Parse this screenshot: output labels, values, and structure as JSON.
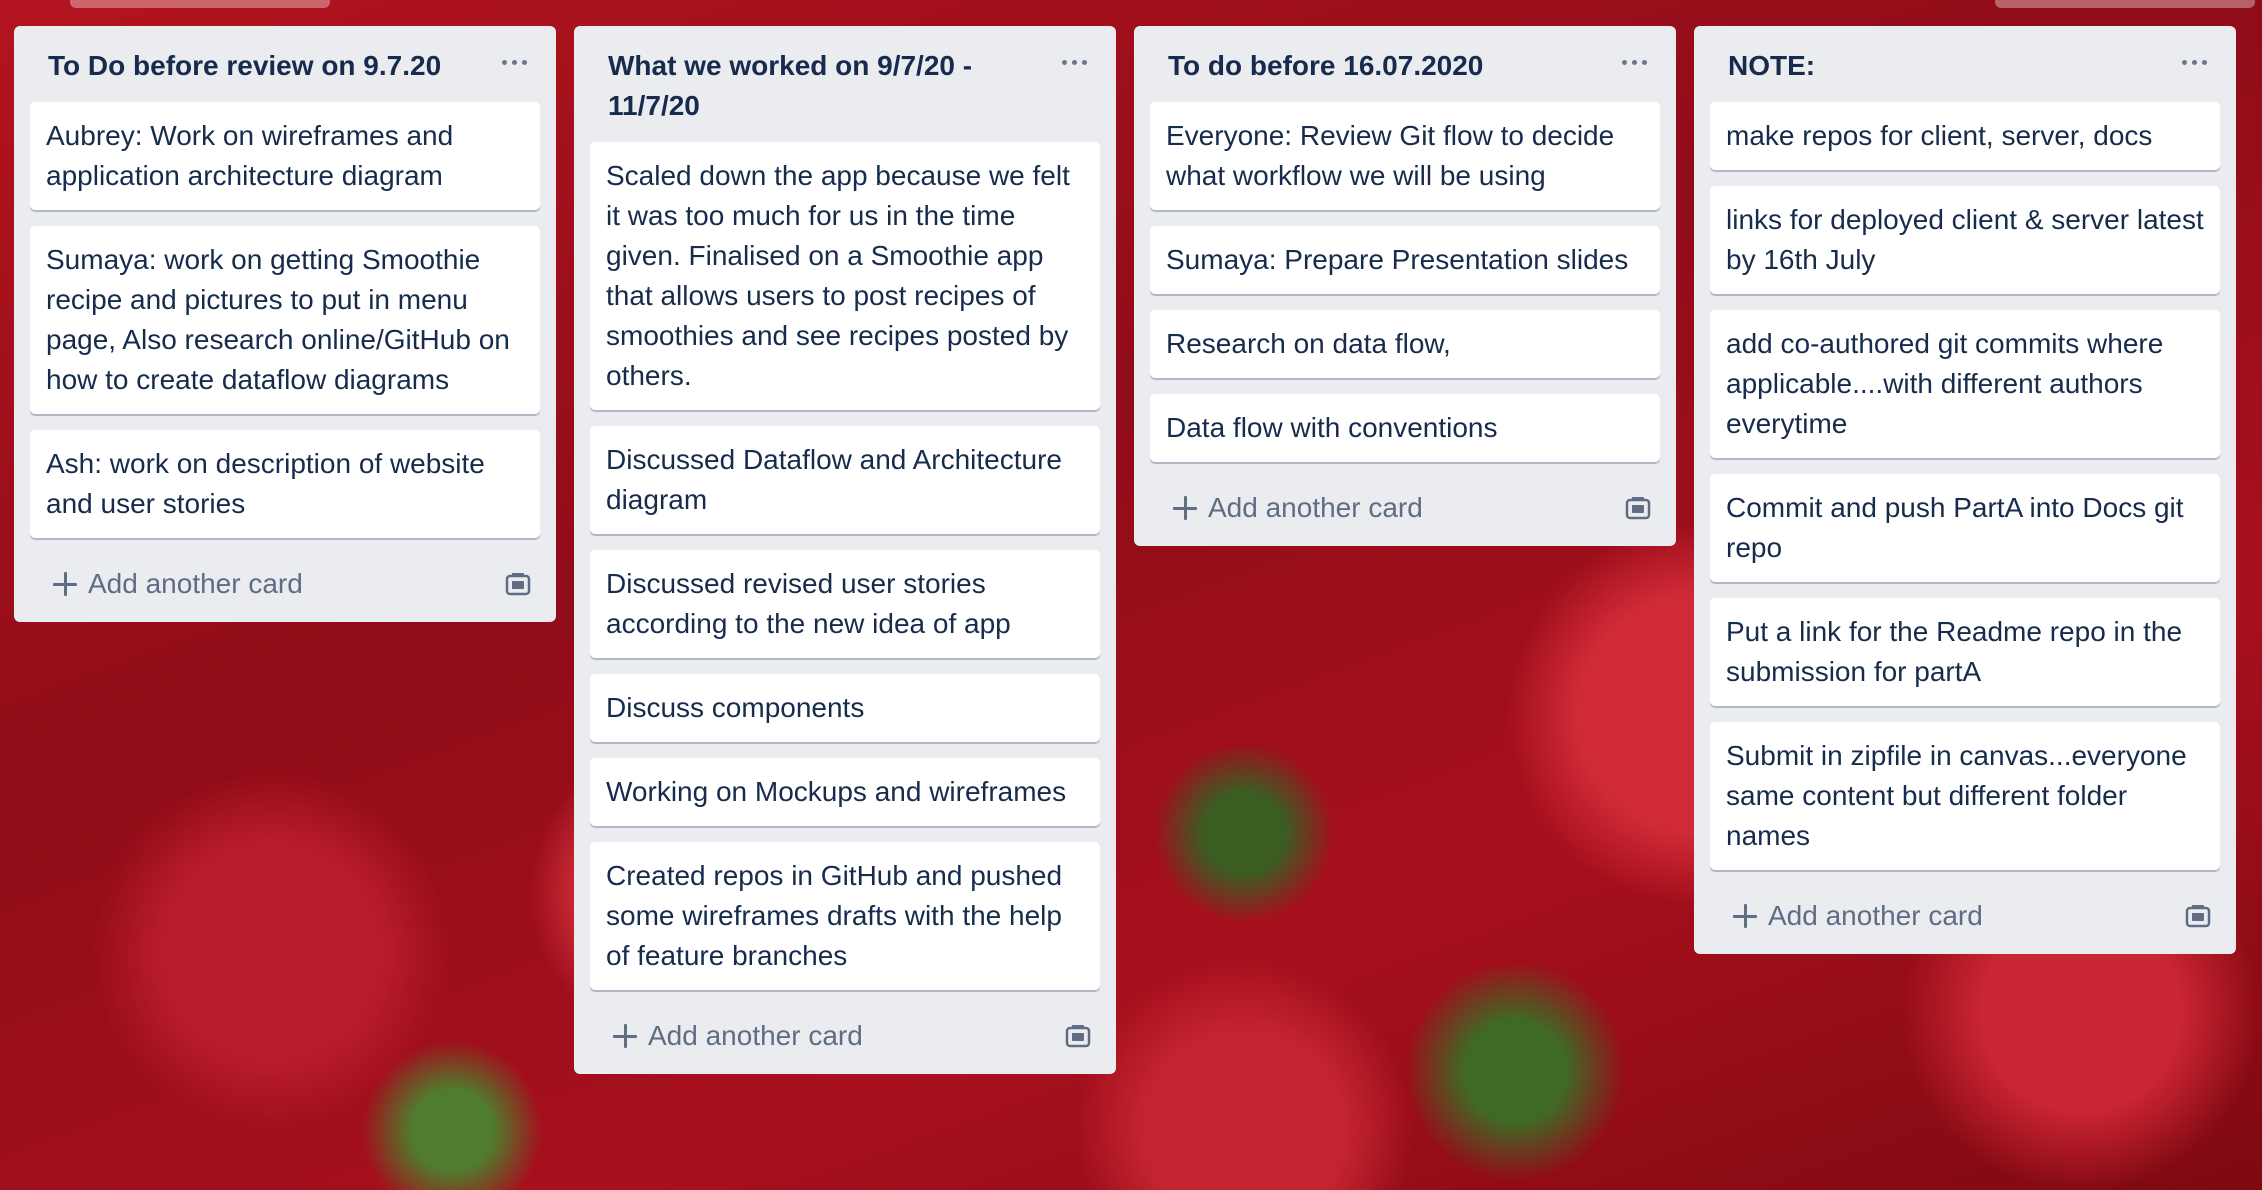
{
  "board": {
    "lists": [
      {
        "title": "To Do before review on 9.7.20",
        "cards": [
          "Aubrey: Work on wireframes and application architecture diagram",
          "Sumaya: work on getting Smoothie recipe and pictures to put in menu page, Also research online/GitHub on how to create dataflow diagrams",
          "Ash: work on description of website and user stories"
        ],
        "add_label": "Add another card"
      },
      {
        "title": "What we worked on 9/7/20 - 11/7/20",
        "cards": [
          "Scaled down the app because we felt it was too much for us in the time given. Finalised on a Smoothie app that allows users to post recipes of smoothies and see recipes posted by others.",
          "Discussed Dataflow and Architecture diagram",
          "Discussed revised user stories according to the new idea of app",
          "Discuss components",
          "Working on Mockups and wireframes",
          "Created repos in GitHub and pushed some wireframes drafts with the help of feature branches"
        ],
        "add_label": "Add another card"
      },
      {
        "title": "To do before 16.07.2020",
        "cards": [
          "Everyone: Review Git flow to decide what workflow we will be using",
          "Sumaya: Prepare Presentation slides",
          "Research on data flow,",
          "Data flow with conventions"
        ],
        "add_label": "Add another card"
      },
      {
        "title": "NOTE:",
        "cards": [
          "make repos for client, server, docs",
          "links for deployed client & server latest by 16th July",
          "add co-authored git commits where applicable....with different authors everytime",
          "Commit and push PartA into Docs git repo",
          "Put a link for the Readme repo in the submission for partA",
          "Submit in zipfile in canvas...everyone same content but different folder names"
        ],
        "add_label": "Add another card"
      }
    ]
  },
  "icons": {
    "list_menu": "more-horizontal-icon",
    "add": "plus-icon",
    "template": "card-template-icon"
  }
}
